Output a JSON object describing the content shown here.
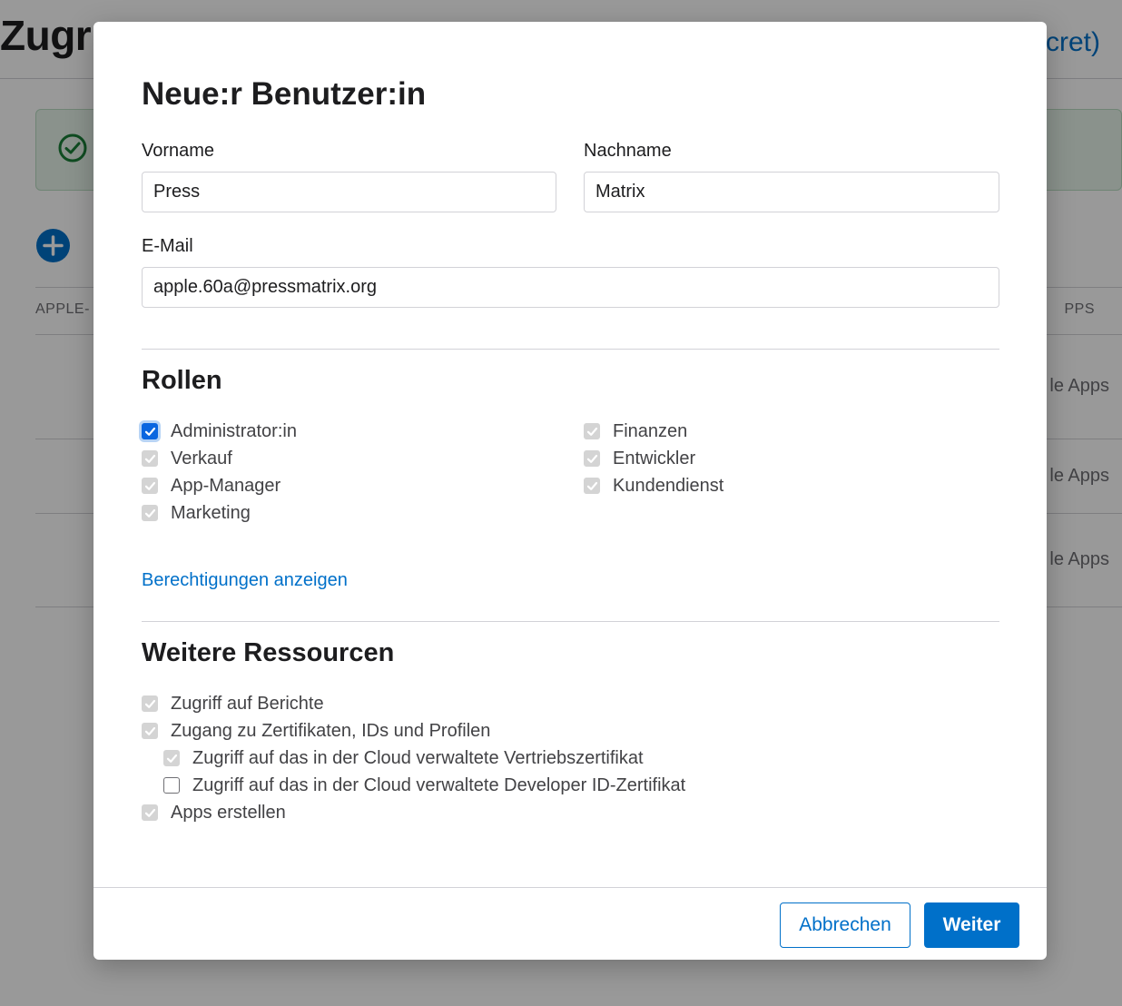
{
  "background": {
    "title_partial": "Zugr",
    "top_link_partial": "cret)",
    "table_header_left_partial": "APPLE-",
    "table_header_right_partial": "PPS",
    "row_right_partials": [
      "le Apps",
      "le Apps",
      "le Apps"
    ]
  },
  "modal": {
    "title": "Neue:r Benutzer:in",
    "first_name": {
      "label": "Vorname",
      "value": "Press"
    },
    "last_name": {
      "label": "Nachname",
      "value": "Matrix"
    },
    "email": {
      "label": "E-Mail",
      "value": "apple.60a@pressmatrix.org"
    },
    "roles": {
      "title": "Rollen",
      "items": [
        {
          "label": "Administrator:in",
          "checked": true,
          "disabled": false
        },
        {
          "label": "Verkauf",
          "checked": true,
          "disabled": true
        },
        {
          "label": "App-Manager",
          "checked": true,
          "disabled": true
        },
        {
          "label": "Marketing",
          "checked": true,
          "disabled": true
        },
        {
          "label": "Finanzen",
          "checked": true,
          "disabled": true
        },
        {
          "label": "Entwickler",
          "checked": true,
          "disabled": true
        },
        {
          "label": "Kundendienst",
          "checked": true,
          "disabled": true
        }
      ],
      "permissions_link": "Berechtigungen anzeigen"
    },
    "resources": {
      "title": "Weitere Ressourcen",
      "items": [
        {
          "label": "Zugriff auf Berichte",
          "checked": true,
          "disabled": true
        },
        {
          "label": "Zugang zu Zertifikaten, IDs und Profilen",
          "checked": true,
          "disabled": true
        },
        {
          "label": "Zugriff auf das in der Cloud verwaltete Vertriebszertifikat",
          "checked": true,
          "disabled": true
        },
        {
          "label": "Zugriff auf das in der Cloud verwaltete Developer ID-Zertifikat",
          "checked": false,
          "disabled": false
        },
        {
          "label": "Apps erstellen",
          "checked": true,
          "disabled": true
        }
      ]
    },
    "buttons": {
      "cancel": "Abbrechen",
      "next": "Weiter"
    }
  },
  "colors": {
    "accent": "#0070c9",
    "checkbox_active": "#0a66e0",
    "checkbox_disabled": "#d4d4d4",
    "text": "#1d1d1f",
    "overlay": "rgba(0,0,0,0.4)"
  }
}
